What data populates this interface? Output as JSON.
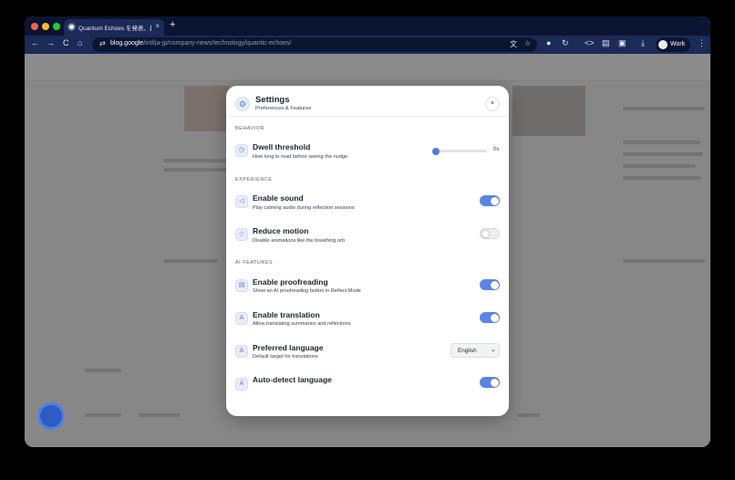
{
  "browser": {
    "tab_title": "Quantum Echoes を発表、最先",
    "tab_close": "×",
    "new_tab": "+",
    "back": "←",
    "forward": "→",
    "reload": "C",
    "home": "⌂",
    "url_host": "blog.google",
    "url_path": "/intl/ja-jp/company-news/technology/quantic-echoes/",
    "profile_label": "Work"
  },
  "settings": {
    "title": "Settings",
    "subtitle": "Preferences & Features",
    "close": "×",
    "sections": {
      "behavior": "BEHAVIOR",
      "experience": "EXPERIENCE",
      "ai": "AI FEATURES"
    },
    "dwell": {
      "title": "Dwell threshold",
      "desc": "How long to read before seeing the nudge",
      "value": "0s",
      "level": 0
    },
    "sound": {
      "title": "Enable sound",
      "desc": "Play calming audio during reflection sessions",
      "enabled": true
    },
    "motion": {
      "title": "Reduce motion",
      "desc": "Disable animations like the breathing orb",
      "enabled": false
    },
    "proofreading": {
      "title": "Enable proofreading",
      "desc": "Show an AI proofreading button in Reflect Mode",
      "enabled": true
    },
    "translation": {
      "title": "Enable translation",
      "desc": "Allow translating summaries and reflections",
      "enabled": true
    },
    "language": {
      "title": "Preferred language",
      "desc": "Default target for translations",
      "value": "English"
    },
    "autodetect": {
      "title": "Auto-detect language",
      "enabled": true
    }
  },
  "colors": {
    "accent": "#5b84e4",
    "browser_frame": "#1c2a57"
  }
}
